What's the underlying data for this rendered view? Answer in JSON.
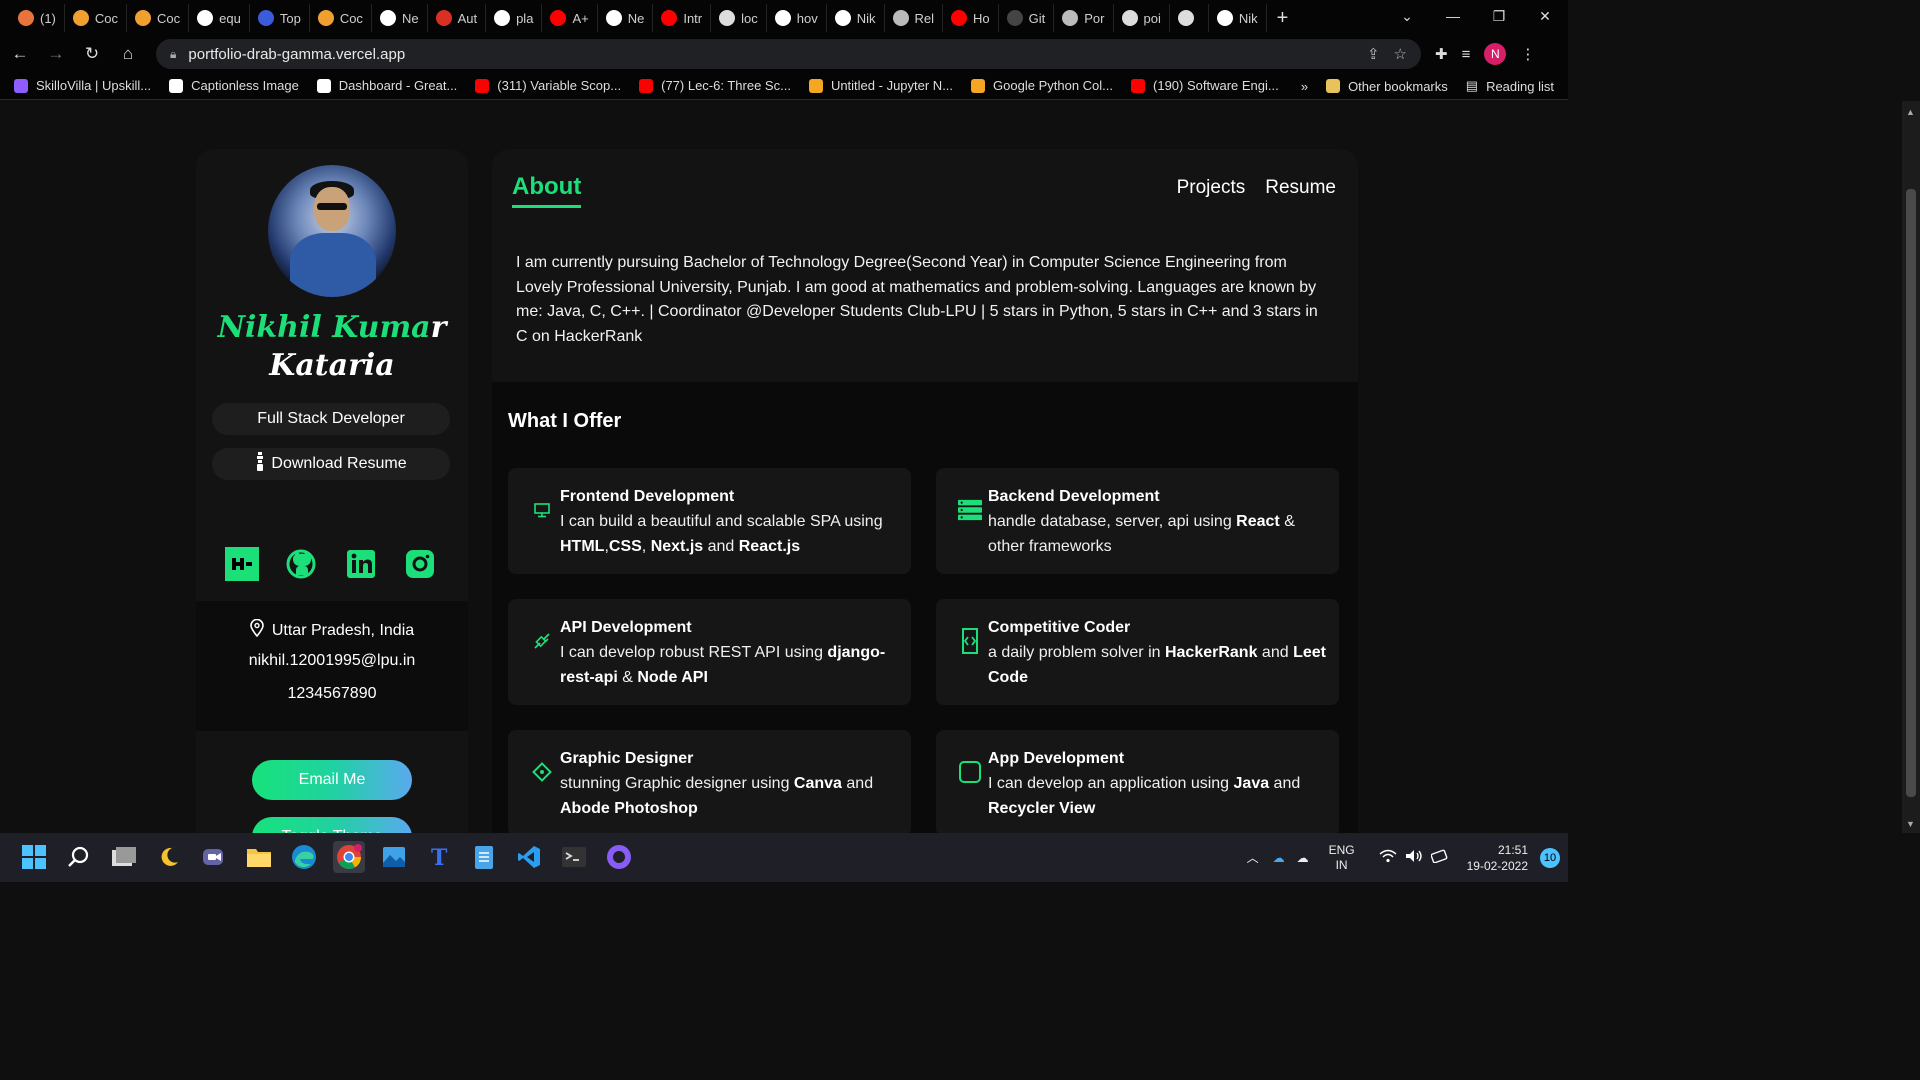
{
  "browser": {
    "tabs": [
      {
        "label": "(1)",
        "color": "#e8743b"
      },
      {
        "label": "Coc",
        "color": "#f0a030"
      },
      {
        "label": "Coc",
        "color": "#f0a030"
      },
      {
        "label": "equ",
        "color": "#ffffff"
      },
      {
        "label": "Top",
        "color": "#3b5bdb"
      },
      {
        "label": "Coc",
        "color": "#f0a030"
      },
      {
        "label": "Ne",
        "color": "#ffffff"
      },
      {
        "label": "Aut",
        "color": "#d93025"
      },
      {
        "label": "pla",
        "color": "#ffffff"
      },
      {
        "label": "A+",
        "color": "#ff0000"
      },
      {
        "label": "Ne",
        "color": "#ffffff"
      },
      {
        "label": "Intr",
        "color": "#ff0000"
      },
      {
        "label": "loc",
        "color": "#dddddd"
      },
      {
        "label": "hov",
        "color": "#ffffff"
      },
      {
        "label": "Nik",
        "color": "#ffffff"
      },
      {
        "label": "Rel",
        "color": "#bbbbbb"
      },
      {
        "label": "Ho",
        "color": "#ff0000"
      },
      {
        "label": "Git",
        "color": "#444444"
      },
      {
        "label": "Por",
        "color": "#bbbbbb"
      },
      {
        "label": "poi",
        "color": "#dddddd"
      },
      {
        "label": "",
        "color": "#dddddd"
      },
      {
        "label": "Nik",
        "color": "#ffffff"
      }
    ],
    "new_tab": "+",
    "window_controls": {
      "chevron": "⌄",
      "minimize": "—",
      "restore": "❐",
      "close": "✕"
    },
    "url": "portfolio-drab-gamma.vercel.app",
    "bookmarks": [
      {
        "label": "SkilloVilla | Upskill...",
        "color": "#8f5cff"
      },
      {
        "label": "Captionless Image",
        "color": "#ffffff"
      },
      {
        "label": "Dashboard - Great...",
        "color": "#ffffff"
      },
      {
        "label": "(311) Variable Scop...",
        "color": "#ff0000"
      },
      {
        "label": "(77) Lec-6: Three Sc...",
        "color": "#ff0000"
      },
      {
        "label": "Untitled - Jupyter N...",
        "color": "#f5a623"
      },
      {
        "label": "Google Python Col...",
        "color": "#f5a623"
      },
      {
        "label": "(190) Software Engi...",
        "color": "#ff0000"
      }
    ],
    "bookmarks_more": "»",
    "other_bookmarks": "Other bookmarks",
    "reading_list": "Reading list",
    "profile_initial": "N"
  },
  "sidebar": {
    "name_part_green": "Nikhil Kuma",
    "name_part_white": "r",
    "name_line2": "Kataria",
    "title": "Full Stack Developer",
    "download": "Download Resume",
    "location": "Uttar Pradesh, India",
    "email": "nikhil.12001995@lpu.in",
    "phone": "1234567890",
    "email_btn": "Email Me",
    "theme_btn": "Toggle Theme"
  },
  "main": {
    "about_tab": "About",
    "nav": [
      "Projects",
      "Resume"
    ],
    "about_text": "I am currently pursuing Bachelor of Technology Degree(Second Year) in Computer Science Engineering from Lovely Professional University, Punjab. I am good at mathematics and problem-solving. Languages are known by me: Java, C, C++. | Coordinator @Developer Students Club-LPU | 5 stars in Python, 5 stars in C++ and 3 stars in C on HackerRank",
    "offer_title": "What I Offer",
    "cards": [
      {
        "title": "Frontend Development",
        "parts": [
          [
            "I can build a beautiful and scalable SPA using ",
            false
          ],
          [
            "HTML",
            true
          ],
          [
            ",",
            false
          ],
          [
            "CSS",
            true
          ],
          [
            ", ",
            false
          ],
          [
            "Next.js",
            true
          ],
          [
            " and ",
            false
          ],
          [
            "React.js",
            true
          ]
        ]
      },
      {
        "title": "Backend Development",
        "parts": [
          [
            "handle database, server, api using ",
            false
          ],
          [
            "React",
            true
          ],
          [
            " & other frameworks",
            false
          ]
        ]
      },
      {
        "title": "API Development",
        "parts": [
          [
            "I can develop robust REST API using ",
            false
          ],
          [
            "django-rest-api",
            true
          ],
          [
            " & ",
            false
          ],
          [
            "Node API",
            true
          ]
        ]
      },
      {
        "title": "Competitive Coder",
        "parts": [
          [
            "a daily problem solver in ",
            false
          ],
          [
            "HackerRank",
            true
          ],
          [
            " and ",
            false
          ],
          [
            "Leet Code",
            true
          ]
        ]
      },
      {
        "title": "Graphic Designer",
        "parts": [
          [
            "stunning Graphic designer using ",
            false
          ],
          [
            "Canva",
            true
          ],
          [
            " and ",
            false
          ],
          [
            "Abode Photoshop",
            true
          ]
        ]
      },
      {
        "title": "App Development",
        "parts": [
          [
            "I can develop an application using ",
            false
          ],
          [
            "Java",
            true
          ],
          [
            " and ",
            false
          ],
          [
            "Recycler View",
            true
          ]
        ]
      }
    ]
  },
  "taskbar": {
    "lang": "ENG",
    "region": "IN",
    "time": "21:51",
    "date": "19-02-2022",
    "notif": "10"
  },
  "colors": {
    "accent": "#1ddf7a"
  }
}
